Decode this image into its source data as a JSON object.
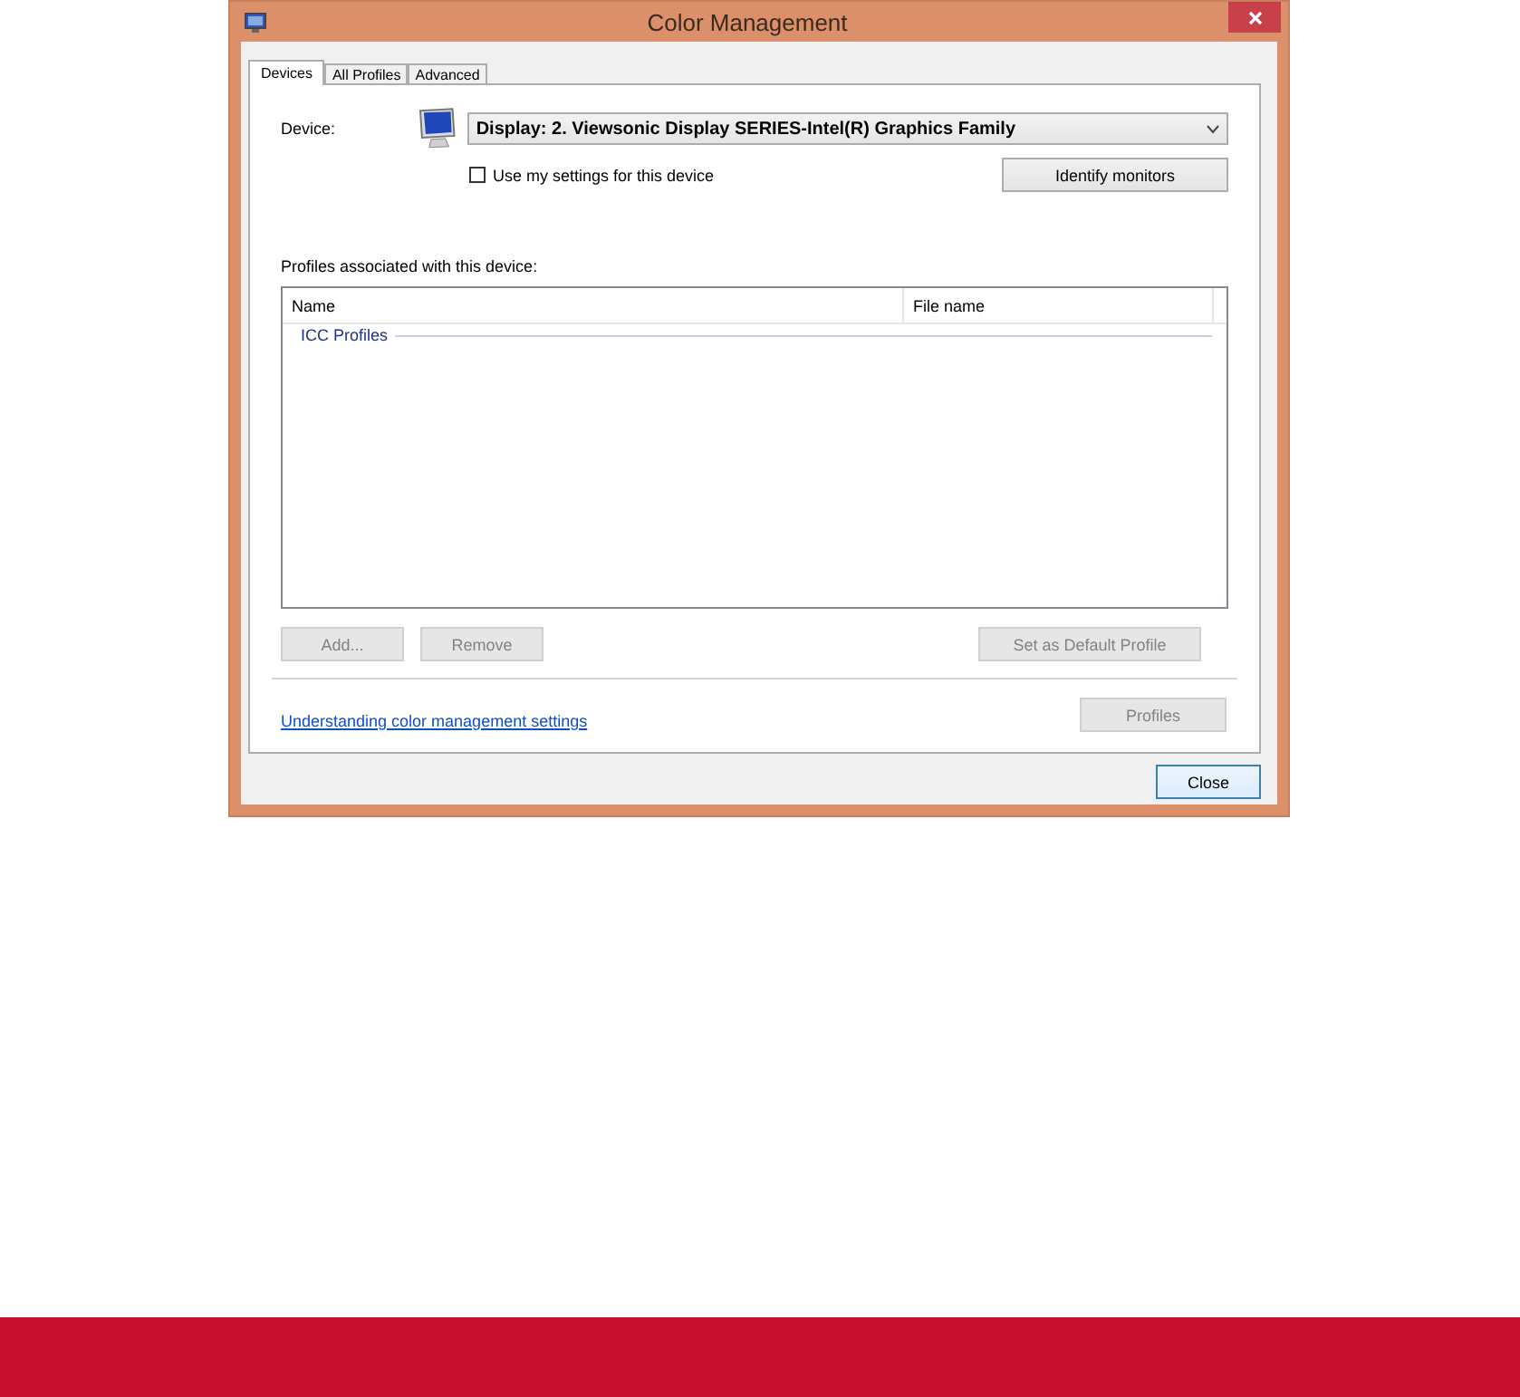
{
  "window": {
    "title": "Color Management"
  },
  "tabs": [
    {
      "label": "Devices",
      "selected": true
    },
    {
      "label": "All Profiles",
      "selected": false
    },
    {
      "label": "Advanced",
      "selected": false
    }
  ],
  "device": {
    "label": "Device:",
    "value": "Display: 2. Viewsonic Display SERIES-Intel(R) Graphics Family"
  },
  "use_my_settings": {
    "label": "Use my settings for this device",
    "checked": false
  },
  "identify_button": {
    "label": "Identify monitors",
    "disabled": false
  },
  "profiles": {
    "label": "Profiles associated with this device:",
    "columns": [
      "Name",
      "File name"
    ],
    "groups": [
      {
        "label": "ICC Profiles"
      }
    ]
  },
  "list_buttons": [
    {
      "label": "Add...",
      "disabled": true
    },
    {
      "label": "Remove",
      "disabled": true
    },
    {
      "label": "Set as Default Profile",
      "disabled": true
    }
  ],
  "link": "Understanding color management settings",
  "profiles_button": {
    "label": "Profiles",
    "disabled": true
  },
  "close_button": {
    "label": "Close",
    "disabled": false
  }
}
